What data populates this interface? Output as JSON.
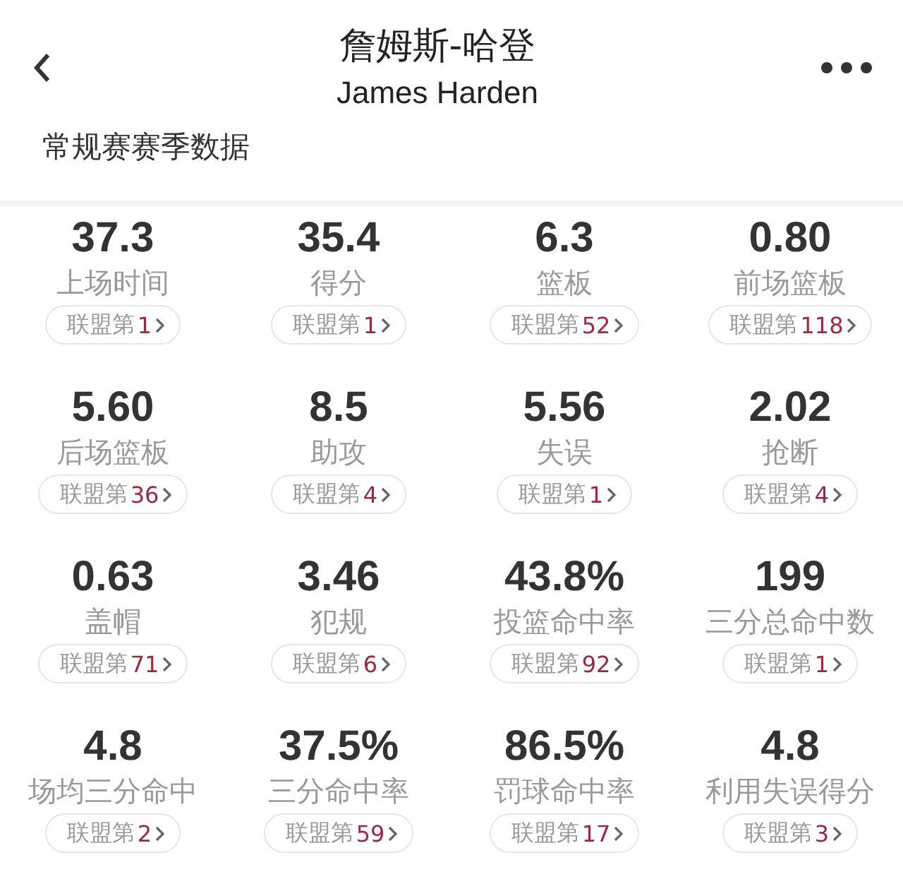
{
  "header": {
    "title": "詹姆斯-哈登",
    "subtitle": "James Harden"
  },
  "section_title": "常规赛赛季数据",
  "stats": [
    {
      "value": "37.3",
      "label": "上场时间",
      "rank_prefix": "联盟第",
      "rank": "1"
    },
    {
      "value": "35.4",
      "label": "得分",
      "rank_prefix": "联盟第",
      "rank": "1"
    },
    {
      "value": "6.3",
      "label": "篮板",
      "rank_prefix": "联盟第",
      "rank": "52"
    },
    {
      "value": "0.80",
      "label": "前场篮板",
      "rank_prefix": "联盟第",
      "rank": "118"
    },
    {
      "value": "5.60",
      "label": "后场篮板",
      "rank_prefix": "联盟第",
      "rank": "36"
    },
    {
      "value": "8.5",
      "label": "助攻",
      "rank_prefix": "联盟第",
      "rank": "4"
    },
    {
      "value": "5.56",
      "label": "失误",
      "rank_prefix": "联盟第",
      "rank": "1"
    },
    {
      "value": "2.02",
      "label": "抢断",
      "rank_prefix": "联盟第",
      "rank": "4"
    },
    {
      "value": "0.63",
      "label": "盖帽",
      "rank_prefix": "联盟第",
      "rank": "71"
    },
    {
      "value": "3.46",
      "label": "犯规",
      "rank_prefix": "联盟第",
      "rank": "6"
    },
    {
      "value": "43.8%",
      "label": "投篮命中率",
      "rank_prefix": "联盟第",
      "rank": "92"
    },
    {
      "value": "199",
      "label": "三分总命中数",
      "rank_prefix": "联盟第",
      "rank": "1"
    },
    {
      "value": "4.8",
      "label": "场均三分命中",
      "rank_prefix": "联盟第",
      "rank": "2"
    },
    {
      "value": "37.5%",
      "label": "三分命中率",
      "rank_prefix": "联盟第",
      "rank": "59"
    },
    {
      "value": "86.5%",
      "label": "罚球命中率",
      "rank_prefix": "联盟第",
      "rank": "17"
    },
    {
      "value": "4.8",
      "label": "利用失误得分",
      "rank_prefix": "联盟第",
      "rank": "3"
    }
  ]
}
